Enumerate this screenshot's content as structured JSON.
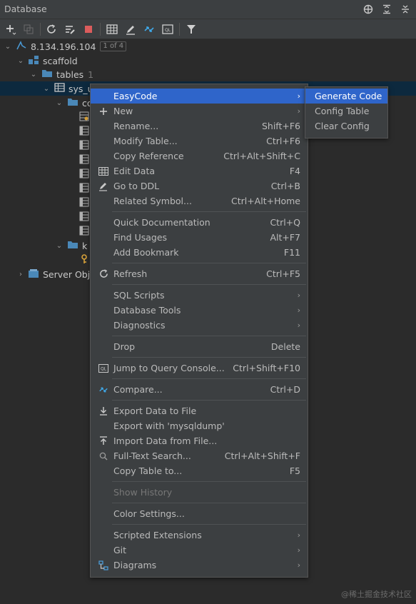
{
  "window": {
    "title": "Database"
  },
  "tree": {
    "datasource": {
      "label": "8.134.196.104",
      "badge": "1 of 4"
    },
    "schema": "scaffold",
    "tables": {
      "label": "tables",
      "count": "1"
    },
    "table": "sys_u",
    "columns_label": "co",
    "keys_label": "k",
    "server_objects": "Server Obj"
  },
  "menu": {
    "items": [
      {
        "label": "EasyCode",
        "arrow": "›"
      },
      {
        "label": "New",
        "arrow": "›"
      },
      {
        "label": "Rename...",
        "shortcut": "Shift+F6"
      },
      {
        "label": "Modify Table...",
        "shortcut": "Ctrl+F6"
      },
      {
        "label": "Copy Reference",
        "shortcut": "Ctrl+Alt+Shift+C"
      },
      {
        "label": "Edit Data",
        "shortcut": "F4"
      },
      {
        "label": "Go to DDL",
        "shortcut": "Ctrl+B"
      },
      {
        "label": "Related Symbol...",
        "shortcut": "Ctrl+Alt+Home"
      },
      {
        "label": "Quick Documentation",
        "shortcut": "Ctrl+Q"
      },
      {
        "label": "Find Usages",
        "shortcut": "Alt+F7"
      },
      {
        "label": "Add Bookmark",
        "shortcut": "F11"
      },
      {
        "label": "Refresh",
        "shortcut": "Ctrl+F5"
      },
      {
        "label": "SQL Scripts",
        "arrow": "›"
      },
      {
        "label": "Database Tools",
        "arrow": "›"
      },
      {
        "label": "Diagnostics",
        "arrow": "›"
      },
      {
        "label": "Drop",
        "shortcut": "Delete"
      },
      {
        "label": "Jump to Query Console...",
        "shortcut": "Ctrl+Shift+F10"
      },
      {
        "label": "Compare...",
        "shortcut": "Ctrl+D"
      },
      {
        "label": "Export Data to File"
      },
      {
        "label": "Export with 'mysqldump'"
      },
      {
        "label": "Import Data from File..."
      },
      {
        "label": "Full-Text Search...",
        "shortcut": "Ctrl+Alt+Shift+F"
      },
      {
        "label": "Copy Table to...",
        "shortcut": "F5"
      },
      {
        "label": "Show History"
      },
      {
        "label": "Color Settings..."
      },
      {
        "label": "Scripted Extensions",
        "arrow": "›"
      },
      {
        "label": "Git",
        "arrow": "›"
      },
      {
        "label": "Diagrams",
        "arrow": "›"
      }
    ]
  },
  "submenu": {
    "items": [
      {
        "label": "Generate Code"
      },
      {
        "label": "Config Table"
      },
      {
        "label": "Clear Config"
      }
    ]
  },
  "colors": {
    "accent": "#2f65ca",
    "selection": "#0d293e",
    "background": "#2b2b2b",
    "panel": "#3c3f41"
  },
  "watermark": "@稀土掘金技术社区"
}
